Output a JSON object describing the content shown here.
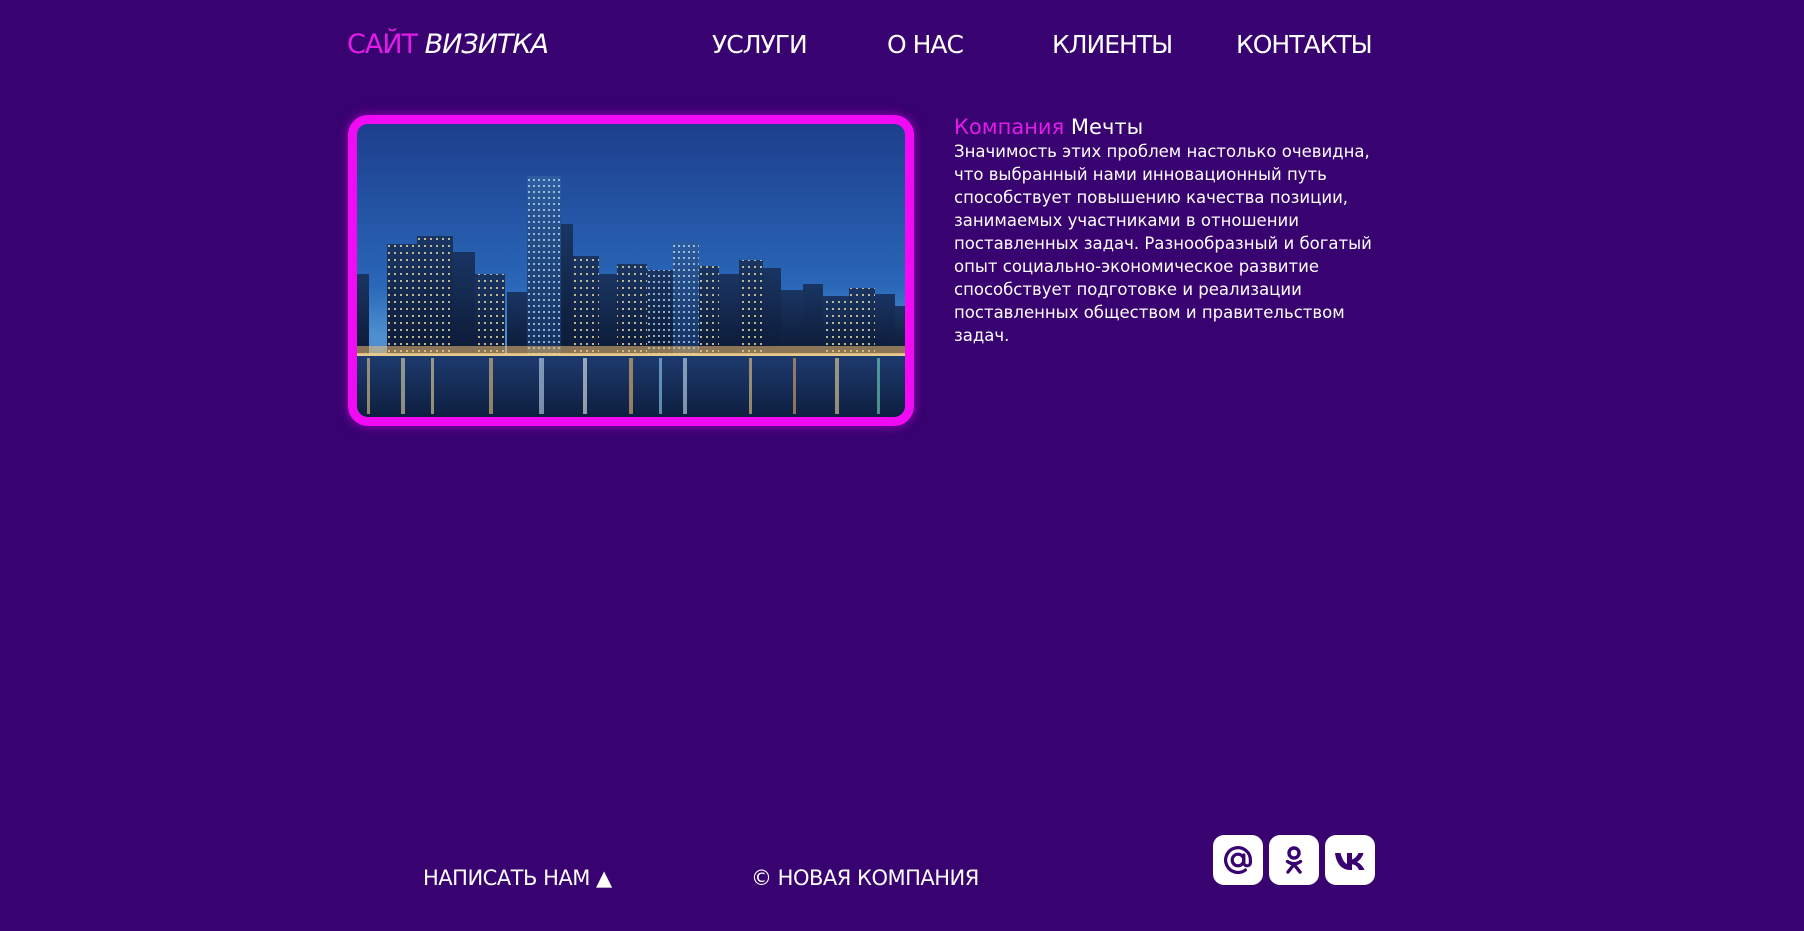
{
  "header": {
    "logo": {
      "accent": "САЙТ",
      "main": "ВИЗИТКА"
    },
    "nav": [
      {
        "label": "УСЛУГИ"
      },
      {
        "label": "О НАС"
      },
      {
        "label": "КЛИЕНТЫ"
      },
      {
        "label": "КОНТАКТЫ"
      }
    ]
  },
  "hero": {
    "image": "city-skyline-at-night",
    "frame_color": "#f10bf4"
  },
  "about": {
    "title_accent": "Компания",
    "title_main": "Мечты",
    "text": "Значимость этих проблем настолько очевидна, что выбранный нами инновационный путь способствует повышению качества позиции, занимаемых участниками в отношении поставленных задач. Разнообразный и богатый опыт социально-экономическое развитие способствует подготовке и реализации поставленных обществом и правительством задач."
  },
  "footer": {
    "write_us": "НАПИСАТЬ НАМ ▲",
    "copyright": "© НОВАЯ КОМПАНИЯ",
    "social": [
      {
        "icon": "mail-at-icon"
      },
      {
        "icon": "odnoklassniki-icon"
      },
      {
        "icon": "vk-icon"
      }
    ]
  },
  "colors": {
    "background": "#380270",
    "accent": "#e21ce9",
    "text": "#ffffff"
  }
}
